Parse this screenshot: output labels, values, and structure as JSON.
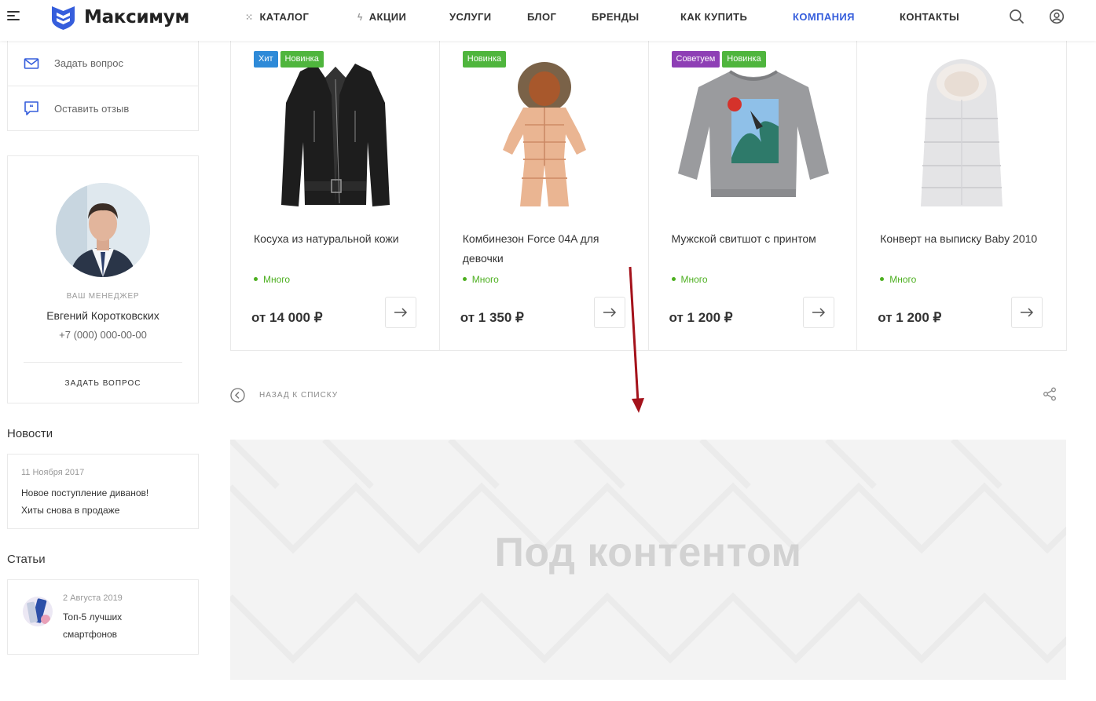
{
  "header": {
    "logo_text": "Максимум",
    "nav": [
      {
        "label": "КАТАЛОГ",
        "icon": "grid-dots-icon"
      },
      {
        "label": "АКЦИИ",
        "icon": "lightning-icon"
      },
      {
        "label": "УСЛУГИ"
      },
      {
        "label": "БЛОГ"
      },
      {
        "label": "БРЕНДЫ"
      },
      {
        "label": "КАК КУПИТЬ"
      },
      {
        "label": "КОМПАНИЯ",
        "active": true
      },
      {
        "label": "КОНТАКТЫ"
      }
    ],
    "accent_color": "#365edc"
  },
  "sidebar": {
    "actions": [
      {
        "label": "Задать вопрос",
        "icon": "mail-icon"
      },
      {
        "label": "Оставить отзыв",
        "icon": "review-icon"
      }
    ],
    "manager": {
      "caption": "ВАШ МЕНЕДЖЕР",
      "name": "Евгений Коротковских",
      "phone": "+7 (000) 000-00-00",
      "button": "ЗАДАТЬ ВОПРОС"
    },
    "news": {
      "title": "Новости",
      "items": [
        {
          "date": "11 Ноября 2017",
          "text": "Новое поступление диванов! Хиты снова в продаже"
        }
      ]
    },
    "articles": {
      "title": "Статьи",
      "items": [
        {
          "date": "2 Августа 2019",
          "text": "Топ-5 лучших смартфонов"
        }
      ]
    }
  },
  "products": [
    {
      "name": "Косуха из натуральной кожи",
      "stock": "Много",
      "price": "от 14 000 ₽",
      "stickers": [
        {
          "label": "Хит",
          "color": "#2e8ad8"
        },
        {
          "label": "Новинка",
          "color": "#4fb53d"
        }
      ]
    },
    {
      "name": "Комбинезон Force 04A для девочки",
      "stock": "Много",
      "price": "от 1 350 ₽",
      "stickers": [
        {
          "label": "Новинка",
          "color": "#4fb53d"
        }
      ]
    },
    {
      "name": "Мужской свитшот с принтом",
      "stock": "Много",
      "price": "от 1 200 ₽",
      "stickers": [
        {
          "label": "Советуем",
          "color": "#8e3fb5"
        },
        {
          "label": "Новинка",
          "color": "#4fb53d"
        }
      ]
    },
    {
      "name": "Конверт на выписку Baby 2010",
      "stock": "Много",
      "price": "от 1 200 ₽",
      "stickers": []
    }
  ],
  "footer_nav": {
    "back_label": "НАЗАД К СПИСКУ"
  },
  "banner": {
    "text": "Под контентом"
  }
}
